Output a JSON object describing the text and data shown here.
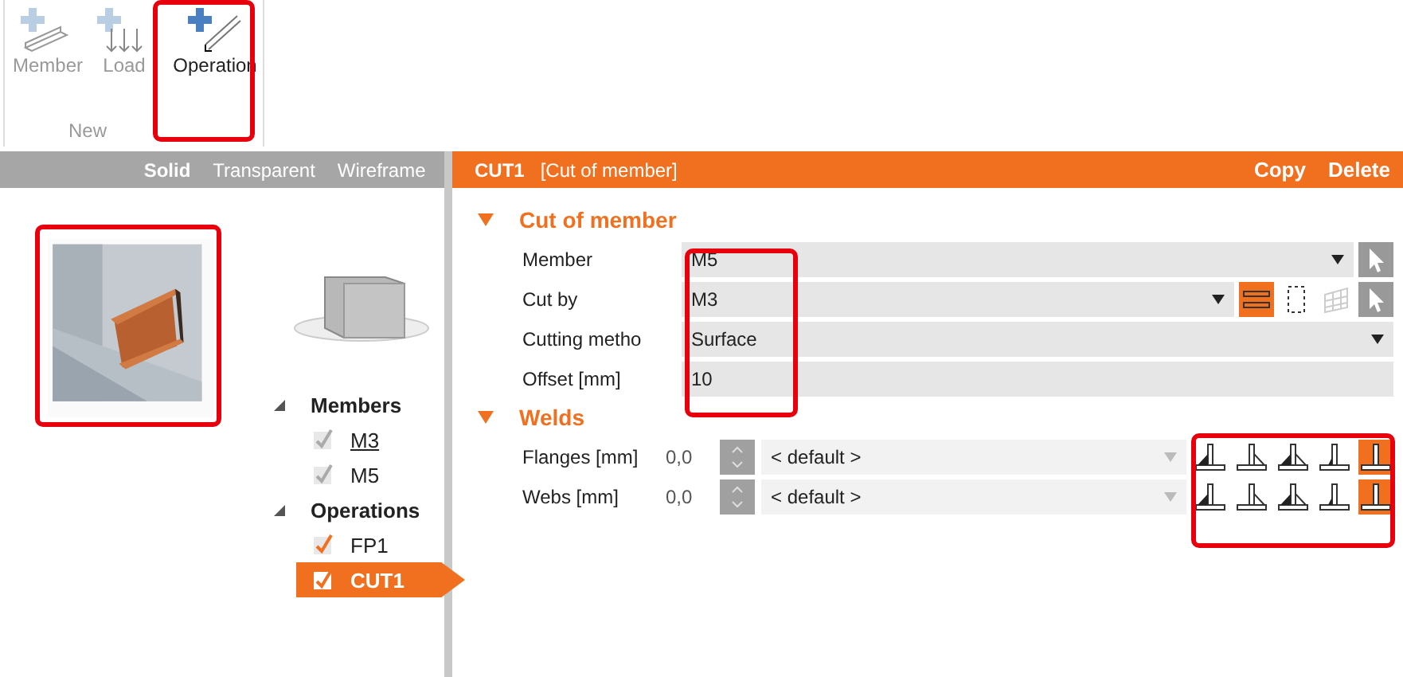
{
  "ribbon": {
    "group_label": "New",
    "buttons": [
      {
        "label": "Member",
        "kind": "member",
        "disabled": true
      },
      {
        "label": "Load",
        "kind": "load",
        "disabled": true
      },
      {
        "label": "Operation",
        "kind": "operation",
        "disabled": false
      }
    ]
  },
  "view_modes": [
    {
      "label": "Solid",
      "selected": true
    },
    {
      "label": "Transparent",
      "selected": false
    },
    {
      "label": "Wireframe",
      "selected": false
    }
  ],
  "tree": [
    {
      "label": "Members",
      "expanded": true,
      "children": [
        {
          "label": "M3",
          "checked": true,
          "disabled": true,
          "hovered": true,
          "selected": false
        },
        {
          "label": "M5",
          "checked": true,
          "disabled": true,
          "hovered": false,
          "selected": false
        }
      ]
    },
    {
      "label": "Operations",
      "expanded": true,
      "children": [
        {
          "label": "FP1",
          "checked": true,
          "disabled": false,
          "hovered": false,
          "selected": false
        },
        {
          "label": "CUT1",
          "checked": true,
          "disabled": false,
          "hovered": false,
          "selected": true
        }
      ]
    }
  ],
  "header": {
    "name": "CUT1",
    "type": "[Cut of member]",
    "actions": [
      "Copy",
      "Delete"
    ]
  },
  "cut_section": {
    "title": "Cut of member",
    "expanded": true,
    "fields": [
      {
        "label": "Member",
        "kind": "dropdown",
        "value": "M5",
        "pick": true
      },
      {
        "label": "Cut by",
        "kind": "dropdown",
        "value": "M3",
        "pick": true,
        "tools": [
          {
            "kind": "section",
            "selected": true,
            "disabled": false
          },
          {
            "kind": "frame",
            "selected": false,
            "disabled": false
          },
          {
            "kind": "grid",
            "selected": false,
            "disabled": true
          }
        ]
      },
      {
        "label": "Cutting metho",
        "kind": "dropdown",
        "value": "Surface",
        "pick": false
      },
      {
        "label": "Offset [mm]",
        "kind": "text",
        "value": "10",
        "pick": false
      }
    ]
  },
  "welds_section": {
    "title": "Welds",
    "expanded": true,
    "rows": [
      {
        "label": "Flanges [mm]",
        "size": "0,0",
        "type": "< default >",
        "options": [
          {
            "kind": "left",
            "selected": false
          },
          {
            "kind": "right",
            "selected": false
          },
          {
            "kind": "both",
            "selected": false
          },
          {
            "kind": "partial",
            "selected": false
          },
          {
            "kind": "butt",
            "selected": true
          }
        ]
      },
      {
        "label": "Webs [mm]",
        "size": "0,0",
        "type": "< default >",
        "options": [
          {
            "kind": "left",
            "selected": false
          },
          {
            "kind": "right",
            "selected": false
          },
          {
            "kind": "both",
            "selected": false
          },
          {
            "kind": "partial",
            "selected": false
          },
          {
            "kind": "butt",
            "selected": true
          }
        ]
      }
    ]
  }
}
